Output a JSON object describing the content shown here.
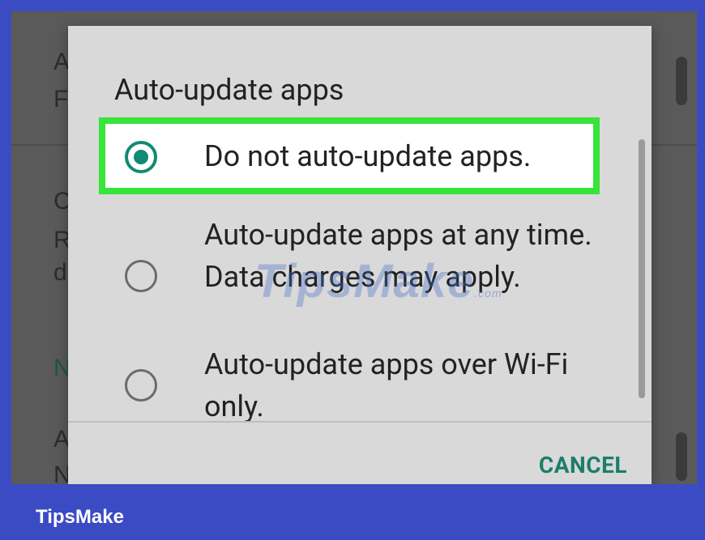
{
  "background": {
    "letters": [
      "A",
      "F",
      "C",
      "R",
      "d",
      "N",
      "A",
      "N"
    ]
  },
  "dialog": {
    "title": "Auto-update apps",
    "options": [
      {
        "label": "Do not auto-update apps.",
        "selected": true
      },
      {
        "label": "Auto-update apps at any time. Data charges may apply.",
        "selected": false
      },
      {
        "label": "Auto-update apps over Wi-Fi only.",
        "selected": false
      }
    ],
    "cancel_label": "CANCEL"
  },
  "watermark": {
    "text": "TipsMake",
    "suffix": ".com"
  },
  "footer": {
    "brand": "TipsMake"
  },
  "colors": {
    "accent": "#118a74",
    "highlight": "#36e43a",
    "footer_bg": "#3b4bc4"
  }
}
